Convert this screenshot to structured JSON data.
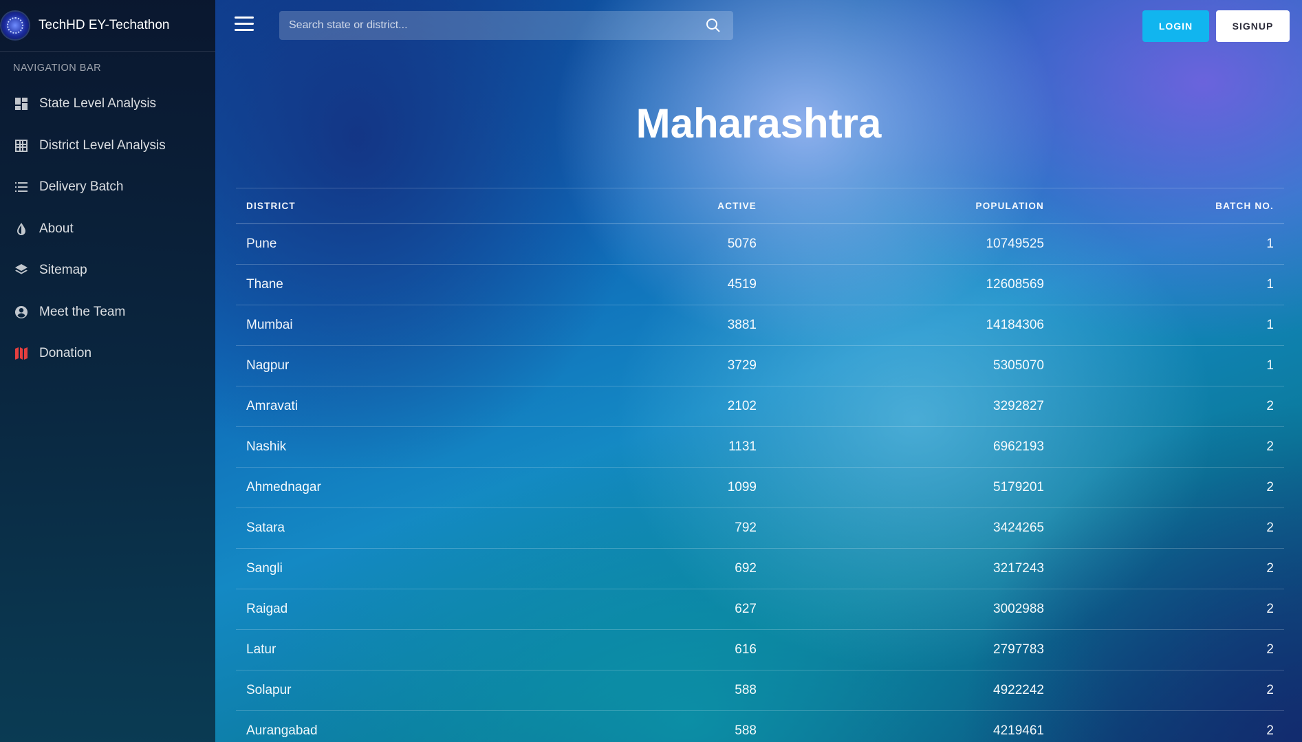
{
  "brand": {
    "title": "TechHD EY-Techathon"
  },
  "sidebar": {
    "caption": "NAVIGATION BAR",
    "items": [
      {
        "label": "State Level Analysis",
        "icon": "dashboard-icon"
      },
      {
        "label": "District Level Analysis",
        "icon": "grid-icon"
      },
      {
        "label": "Delivery Batch",
        "icon": "list-icon"
      },
      {
        "label": "About",
        "icon": "drop-icon"
      },
      {
        "label": "Sitemap",
        "icon": "layers-icon"
      },
      {
        "label": "Meet the Team",
        "icon": "user-circle-icon"
      },
      {
        "label": "Donation",
        "icon": "map-icon"
      }
    ]
  },
  "header": {
    "search_placeholder": "Search state or district...",
    "login_label": "LOGIN",
    "signup_label": "SIGNUP"
  },
  "colors": {
    "login_button": "#11b5ef",
    "signup_button": "#ffffff",
    "donation_icon": "#e53f3f"
  },
  "main": {
    "title": "Maharashtra",
    "table": {
      "columns": [
        "DISTRICT",
        "ACTIVE",
        "POPULATION",
        "BATCH NO."
      ],
      "rows": [
        {
          "district": "Pune",
          "active": "5076",
          "population": "10749525",
          "batch": "1"
        },
        {
          "district": "Thane",
          "active": "4519",
          "population": "12608569",
          "batch": "1"
        },
        {
          "district": "Mumbai",
          "active": "3881",
          "population": "14184306",
          "batch": "1"
        },
        {
          "district": "Nagpur",
          "active": "3729",
          "population": "5305070",
          "batch": "1"
        },
        {
          "district": "Amravati",
          "active": "2102",
          "population": "3292827",
          "batch": "2"
        },
        {
          "district": "Nashik",
          "active": "1131",
          "population": "6962193",
          "batch": "2"
        },
        {
          "district": "Ahmednagar",
          "active": "1099",
          "population": "5179201",
          "batch": "2"
        },
        {
          "district": "Satara",
          "active": "792",
          "population": "3424265",
          "batch": "2"
        },
        {
          "district": "Sangli",
          "active": "692",
          "population": "3217243",
          "batch": "2"
        },
        {
          "district": "Raigad",
          "active": "627",
          "population": "3002988",
          "batch": "2"
        },
        {
          "district": "Latur",
          "active": "616",
          "population": "2797783",
          "batch": "2"
        },
        {
          "district": "Solapur",
          "active": "588",
          "population": "4922242",
          "batch": "2"
        },
        {
          "district": "Aurangabad",
          "active": "588",
          "population": "4219461",
          "batch": "2"
        }
      ]
    }
  }
}
